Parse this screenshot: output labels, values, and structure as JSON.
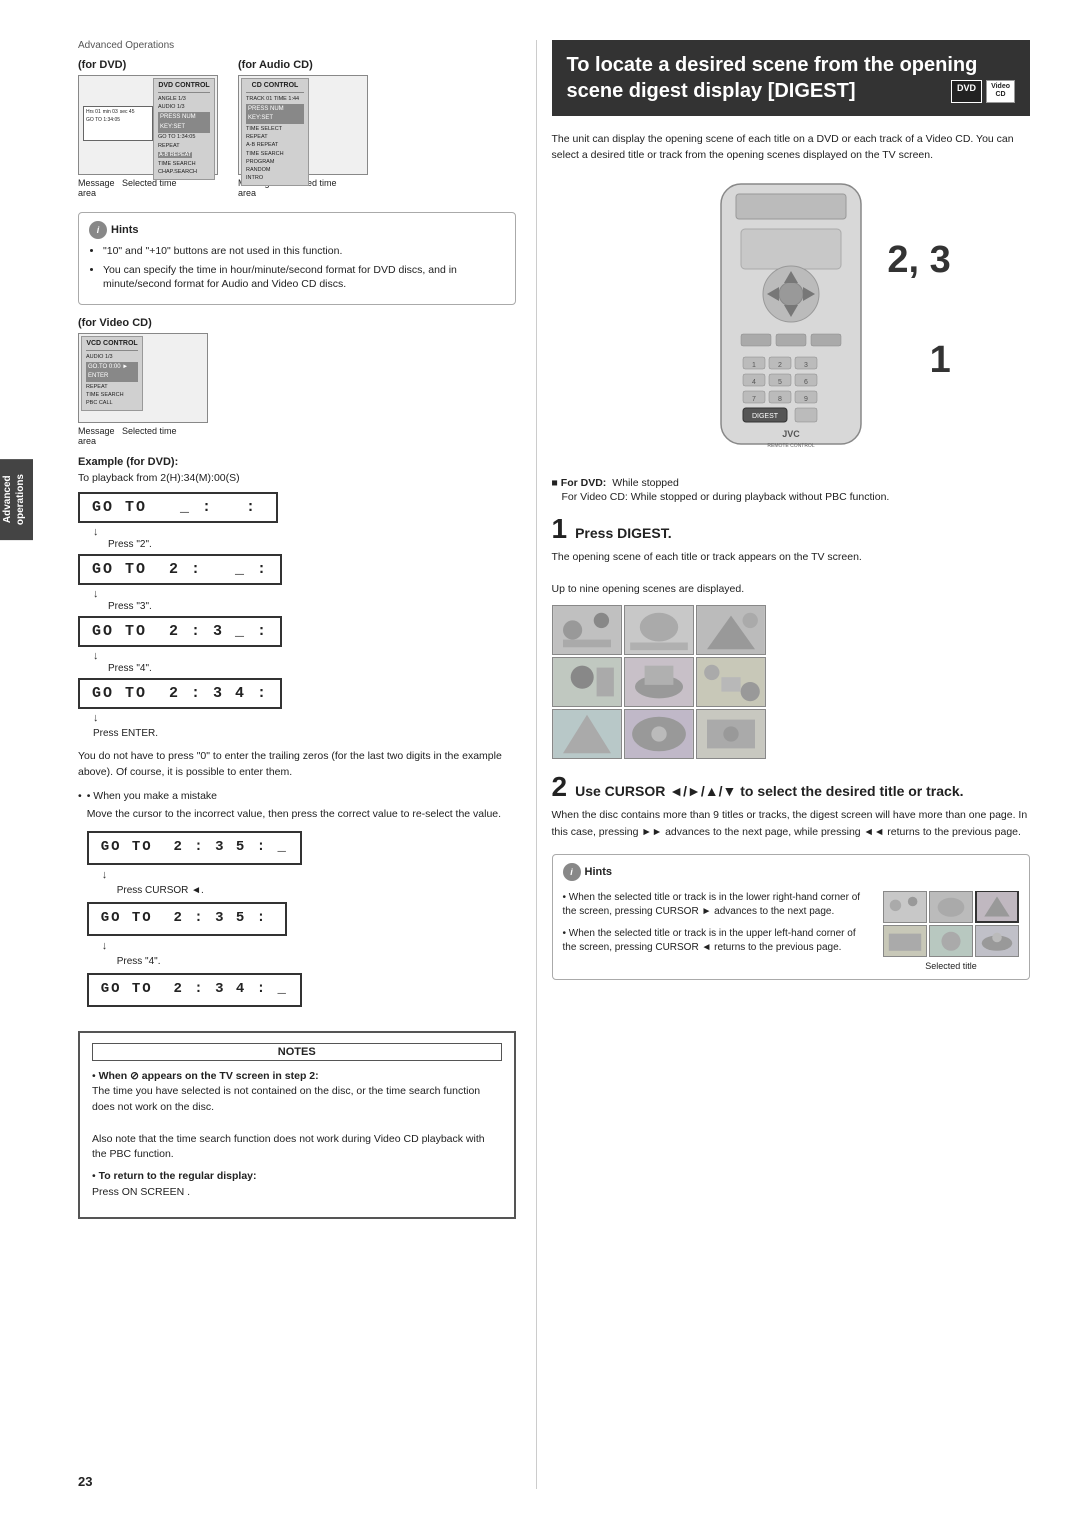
{
  "page": {
    "number": "23",
    "section_label": "Advanced Operations"
  },
  "left_col": {
    "diagrams": {
      "dvd_label": "(for DVD)",
      "audio_cd_label": "(for Audio CD)",
      "video_cd_label": "(for Video CD)",
      "dvd_panel_title": "DVD CONTROL",
      "cd_panel_title": "CD CONTROL",
      "vcd_panel_title": "VCD CONTROL",
      "dvd_items": [
        "ANGLE  1/3",
        "AUDIO  1/3",
        "REPEAT",
        "A-B REPEAT",
        "TIME SEARCH",
        "CHAP.SEARCH"
      ],
      "cd_items": [
        "TRACK 01  TIME  1:44",
        "TIME SELECT",
        "REPEAT",
        "A-B REPEAT",
        "TIME SEARCH",
        "PROGRAM",
        "RANDOM",
        "INTRO"
      ],
      "vcd_items": [
        "AUDIO  1/3",
        "REPEAT",
        "TIME SEARCH",
        "PBC CALL"
      ],
      "dvd_caption": "Message   Selected time area",
      "cd_caption": "Message   Selected time area",
      "vcd_caption": "Message   Selected time area"
    },
    "hints": {
      "title": "Hints",
      "items": [
        "\"10\" and \"+10\" buttons are not used in this function.",
        "You can specify the time in hour/minute/second format for DVD discs, and in minute/second format for Audio and Video CD discs."
      ]
    },
    "example": {
      "label": "Example (for DVD):",
      "subtitle": "To playback from 2(H):34(M):00(S)",
      "goto_sequence": [
        {
          "display": "GO TO  _ :  :",
          "press": "Press \"2\"."
        },
        {
          "display": "GO TO  2 :  _ :",
          "press": "Press \"3\"."
        },
        {
          "display": "GO TO  2 : 3 _ :",
          "press": "Press \"4\"."
        },
        {
          "display": "GO TO  2 : 3 4 :",
          "press": "Press ENTER."
        }
      ]
    },
    "trailing_zeros_text": "You do not have to press \"0\" to enter the trailing zeros (for the last two digits in the example above). Of course, it is possible to enter them.",
    "mistake_section": {
      "label": "• When you make a mistake",
      "body": "Move the cursor to the incorrect value, then press the correct value to re-select the value.",
      "goto_sequence": [
        {
          "display": "GO TO  2 : 3 5 : _",
          "press": "Press CURSOR ◄."
        },
        {
          "display": "GO TO  2 : 3 5 :",
          "press": "Press \"4\"."
        },
        {
          "display": "GO TO  2 : 3 4 : _",
          "press": ""
        }
      ]
    },
    "notes": {
      "title": "NOTES",
      "items": [
        {
          "bold_part": "When  appears on the TV screen in step 2:",
          "body": "The time you have selected is not contained on the disc, or the time search function does not work on the disc.\n\nAlso note that the time search function does not work during Video CD playback with the PBC function."
        },
        {
          "bold_part": "To return to the regular display:",
          "body": "Press ON SCREEN ."
        }
      ]
    }
  },
  "right_col": {
    "heading": "To locate a desired scene from the opening scene digest display [DIGEST]",
    "badge_dvd": "DVD",
    "badge_video_cd": "Video\nCD",
    "intro": "The unit can display the opening scene of each title on a DVD or each track of a Video CD. You can select a desired title or track from the opening scenes displayed on the TV screen.",
    "dvd_note": {
      "for_dvd": "■ For DVD:",
      "dvd_condition": "While stopped",
      "for_video_cd": "For Video CD:",
      "vcd_condition": "While stopped or during playback without PBC function."
    },
    "steps": [
      {
        "num": "1",
        "title": "Press DIGEST.",
        "body": "The opening scene of each title or track appears on the TV screen.",
        "body2": "Up to nine opening scenes are displayed."
      },
      {
        "num": "2",
        "title": "Use CURSOR ◄/►/▲/▼ to select the desired title or track.",
        "body": "When the disc contains more than 9 titles or tracks, the digest screen will have more than one page. In this case, pressing ►► advances to the next page, while pressing ◄◄ returns to the previous page."
      }
    ],
    "hints": {
      "title": "Hints",
      "items": [
        "When the selected title or track is in the lower right-hand corner of the screen, pressing CURSOR ► advances to the next page.",
        "When the selected title or track is in the upper left-hand corner of the screen, pressing CURSOR ◄ returns to the previous page."
      ]
    },
    "selected_title_label": "Selected title",
    "digest_cells": [
      "scene1",
      "scene2",
      "scene3",
      "scene4",
      "scene5",
      "scene6",
      "scene7",
      "scene8",
      "scene9"
    ],
    "selected_cells": [
      "sel1",
      "sel2",
      "sel3",
      "sel4",
      "sel5",
      "sel6"
    ]
  }
}
